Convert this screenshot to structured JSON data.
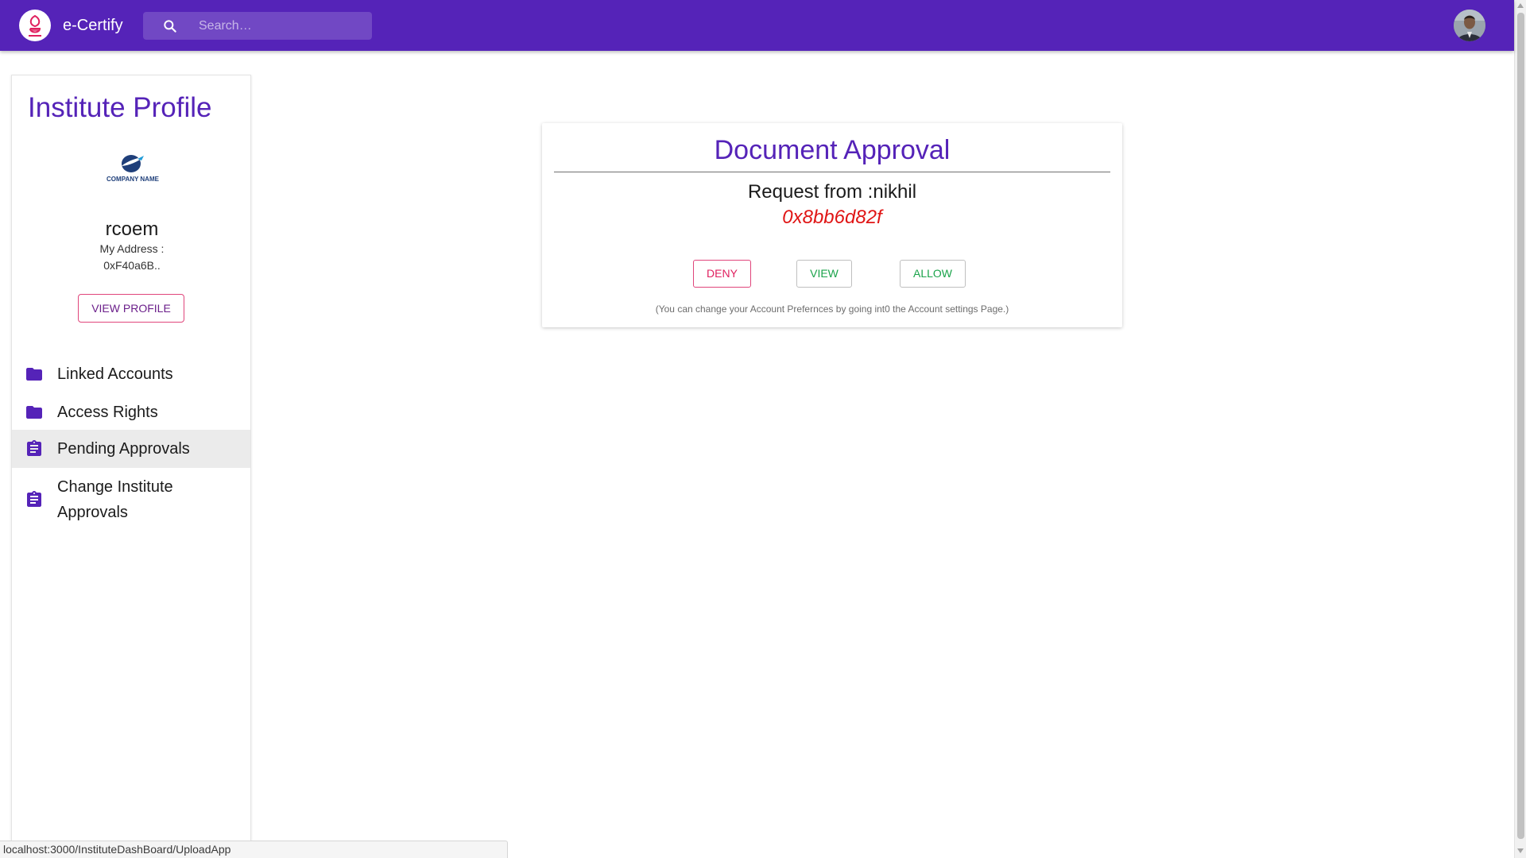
{
  "app": {
    "brand": "e-Certify",
    "logo_icon": "e-certify-logo-icon",
    "search_placeholder": "Search…",
    "avatar_icon": "user-avatar",
    "colors": {
      "primary": "#5523b8",
      "accent": "#e0457b",
      "hash": "#e01515",
      "success": "#1aa34a"
    }
  },
  "sidebar": {
    "title": "Institute Profile",
    "company_logo_text": "COMPANY NAME",
    "institute_name": "rcoem",
    "address_label": "My Address :",
    "address_value": "0xF40a6B..",
    "view_profile_label": "VIEW PROFILE",
    "items": [
      {
        "label": "Linked Accounts",
        "icon": "folder-icon",
        "active": false
      },
      {
        "label": "Access Rights",
        "icon": "folder-icon",
        "active": false
      },
      {
        "label": "Pending Approvals",
        "icon": "clipboard-icon",
        "active": true
      },
      {
        "label": "Change Institute Approvals",
        "icon": "clipboard-icon",
        "active": false
      }
    ]
  },
  "card": {
    "title": "Document Approval",
    "request_text": "Request from :nikhil",
    "hash": "0x8bb6d82f",
    "deny_label": "DENY",
    "view_label": "VIEW",
    "allow_label": "ALLOW",
    "note": "(You can change your Account Prefernces by going int0 the Account settings Page.)"
  },
  "status_bar": {
    "url": "localhost:3000/InstituteDashBoard/UploadApp"
  }
}
